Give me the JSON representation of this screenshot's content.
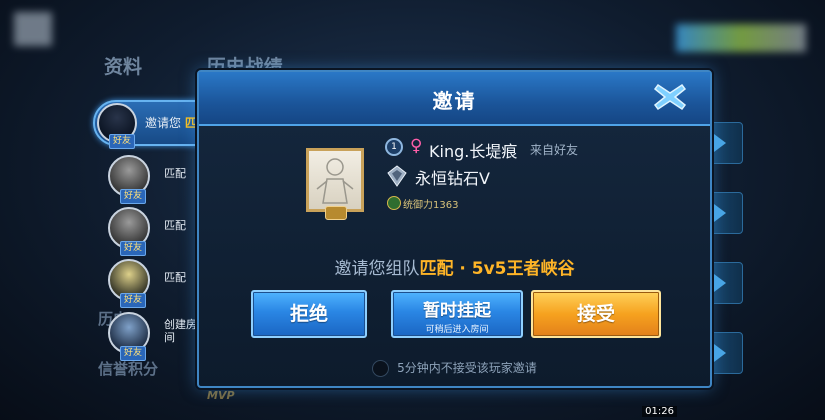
{
  "background": {
    "tabs": [
      "资料",
      "历史战绩"
    ],
    "side_labels": [
      "历史",
      "信誉积分"
    ],
    "mvp_label": "MVP"
  },
  "friends_list": [
    {
      "badge": "好友",
      "status": "邀请您 ",
      "status_highlight": "匹配",
      "active": true
    },
    {
      "badge": "好友",
      "status": "匹配"
    },
    {
      "badge": "好友",
      "status": "匹配"
    },
    {
      "badge": "好友",
      "status": "匹配"
    },
    {
      "badge": "好友",
      "status": "创建房\n间"
    }
  ],
  "dialog": {
    "title": "邀请",
    "close_icon": "close-x-icon",
    "player": {
      "level": "1",
      "gender_icon": "♀",
      "name": "King.长堤痕",
      "source": "来自好友",
      "rank": "永恒钻石V",
      "power": "统御力1363"
    },
    "invite_text_prefix": "邀请您组队",
    "invite_text_mode": "匹配 · 5v5王者峡谷",
    "buttons": {
      "decline": "拒绝",
      "hold": "暂时挂起",
      "hold_sub": "可稍后进入房间",
      "accept": "接受"
    },
    "option_label": "5分钟内不接受该玩家邀请"
  },
  "video_timestamp": "01:26",
  "colors": {
    "accent_blue": "#2a86e4",
    "accent_orange": "#f6a21f",
    "highlight_yellow": "#ffc21a"
  }
}
